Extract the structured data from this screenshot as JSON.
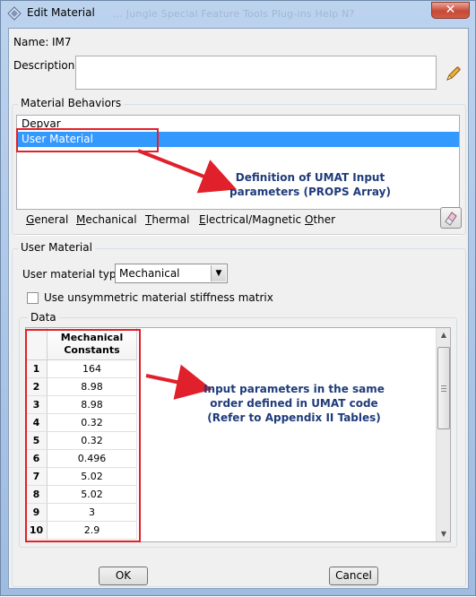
{
  "window": {
    "title": "Edit Material",
    "ghost_menu": "...     Jungle     Special     Feature     Tools     Plug-ins     Help     N?",
    "close_glyph": "✕"
  },
  "name": {
    "label": "Name:",
    "value": "IM7"
  },
  "description": {
    "label": "Description:",
    "value": ""
  },
  "behaviors": {
    "group_title": "Material Behaviors",
    "items": [
      "Depvar",
      "User Material"
    ],
    "selected_index": 1
  },
  "behavior_menu": {
    "items": [
      {
        "accel": "G",
        "rest": "eneral"
      },
      {
        "accel": "M",
        "rest": "echanical"
      },
      {
        "accel": "T",
        "rest": "hermal"
      },
      {
        "accel": "E",
        "rest": "lectrical/Magnetic"
      },
      {
        "accel": "O",
        "rest": "ther"
      }
    ]
  },
  "user_material": {
    "group_title": "User Material",
    "type_label": "User material type:",
    "type_value": "Mechanical",
    "unsymmetric_label": "Use unsymmetric material stiffness matrix",
    "unsymmetric_checked": false
  },
  "data": {
    "group_title": "Data",
    "column_header": [
      "Mechanical",
      "Constants"
    ],
    "rows": [
      {
        "n": "1",
        "v": "164"
      },
      {
        "n": "2",
        "v": "8.98"
      },
      {
        "n": "3",
        "v": "8.98"
      },
      {
        "n": "4",
        "v": "0.32"
      },
      {
        "n": "5",
        "v": "0.32"
      },
      {
        "n": "6",
        "v": "0.496"
      },
      {
        "n": "7",
        "v": "5.02"
      },
      {
        "n": "8",
        "v": "5.02"
      },
      {
        "n": "9",
        "v": "3"
      },
      {
        "n": "10",
        "v": "2.9"
      }
    ]
  },
  "buttons": {
    "ok": "OK",
    "cancel": "Cancel"
  },
  "annotations": {
    "top": [
      "Definition of UMAT Input",
      "parameters (PROPS Array)"
    ],
    "mid": [
      "Input parameters in the same",
      "order defined in UMAT code",
      "(Refer to Appendix II Tables)"
    ],
    "highlight_color": "#e0202a",
    "text_color": "#1f3b7a"
  },
  "icons": {
    "title": "abaqus-app-icon",
    "close": "close-icon",
    "pencil": "pencil-icon",
    "eraser": "eraser-icon",
    "combo": "chevron-down-icon",
    "checkbox": "checkbox-icon"
  }
}
